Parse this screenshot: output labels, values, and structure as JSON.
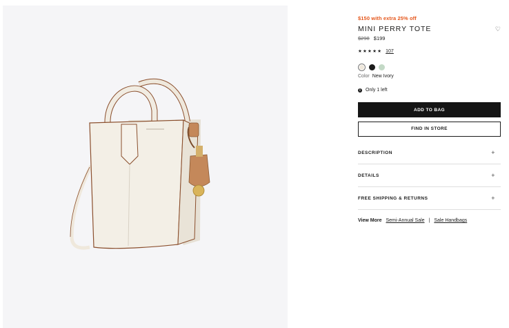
{
  "product": {
    "promo": "$150 with extra 25% off",
    "title": "MINI PERRY TOTE",
    "wishlist_icon": "heart-outline-icon",
    "original_price": "$298",
    "sale_price": "$199",
    "rating_stars": "★★★★★",
    "review_count": "107",
    "swatches": [
      {
        "name": "New Ivory",
        "color": "#efe8dc",
        "selected": true
      },
      {
        "name": "Black",
        "color": "#1c1c1c",
        "selected": false
      },
      {
        "name": "Sage",
        "color": "#c3d9c6",
        "selected": false
      }
    ],
    "color_label": "Color",
    "color_value": "New Ivory",
    "stock_icon": "info-icon",
    "stock_text": "Only 1 left"
  },
  "actions": {
    "add_to_bag": "ADD TO BAG",
    "find_in_store": "FIND IN STORE"
  },
  "accordion": [
    {
      "label": "DESCRIPTION",
      "icon": "+"
    },
    {
      "label": "DETAILS",
      "icon": "+"
    },
    {
      "label": "FREE SHIPPING & RETURNS",
      "icon": "+"
    }
  ],
  "view_more": {
    "label": "View More",
    "links": [
      "Semi-Annual Sale",
      "Sale Handbags"
    ],
    "separator": "|"
  },
  "colors": {
    "promo": "#e5571c",
    "button_dark": "#151515",
    "gallery_bg": "#f5f5f7",
    "bag_body": "#f1ece2",
    "bag_edge": "#8a4e2c",
    "tag_leather": "#c4885a"
  }
}
